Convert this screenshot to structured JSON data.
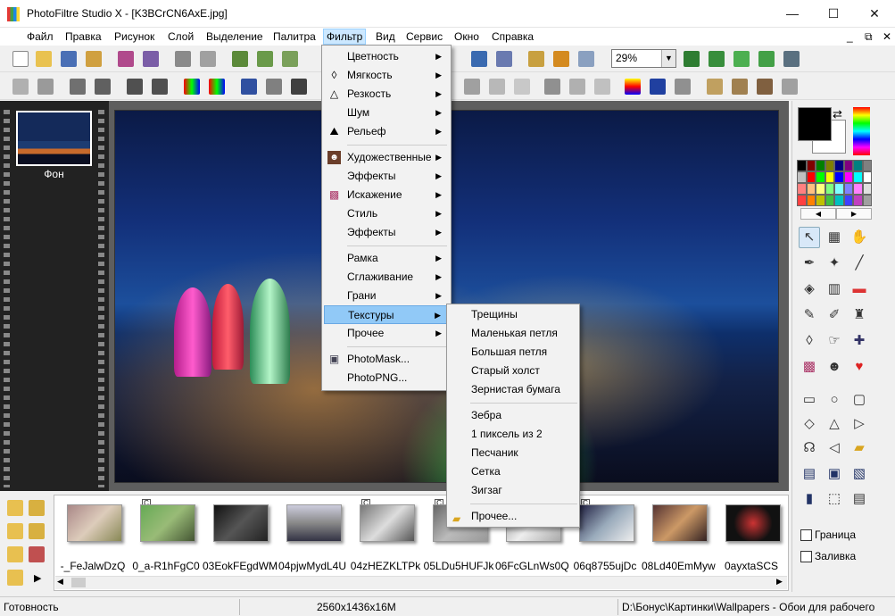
{
  "window": {
    "title": "PhotoFiltre Studio X - [K3BCrCN6AxE.jpg]",
    "minimize": "—",
    "maximize": "☐",
    "close": "✕"
  },
  "menubar": [
    "Файл",
    "Правка",
    "Рисунок",
    "Слой",
    "Выделение",
    "Палитра",
    "Фильтр",
    "Вид",
    "Сервис",
    "Окно",
    "Справка"
  ],
  "mdi": {
    "minimize": "_",
    "restore": "⧉",
    "close": "✕"
  },
  "toolbar": {
    "zoom": "29%"
  },
  "layers": {
    "background_label": "Фон"
  },
  "filter_menu": {
    "items": [
      {
        "label": "Цветность",
        "arrow": "▶"
      },
      {
        "label": "Мягкость",
        "arrow": "▶"
      },
      {
        "label": "Резкость",
        "arrow": "▶"
      },
      {
        "label": "Шум",
        "arrow": "▶"
      },
      {
        "label": "Рельеф",
        "arrow": "▶"
      },
      {
        "label": "Художественные",
        "arrow": "▶"
      },
      {
        "label": "Эффекты",
        "arrow": "▶"
      },
      {
        "label": "Искажение",
        "arrow": "▶"
      },
      {
        "label": "Стиль",
        "arrow": "▶"
      },
      {
        "label": "Эффекты",
        "arrow": "▶"
      },
      {
        "label": "Рамка",
        "arrow": "▶"
      },
      {
        "label": "Сглаживание",
        "arrow": "▶"
      },
      {
        "label": "Грани",
        "arrow": "▶"
      },
      {
        "label": "Текстуры",
        "arrow": "▶"
      },
      {
        "label": "Прочее",
        "arrow": "▶"
      },
      {
        "label": "PhotoMask...",
        "arrow": ""
      },
      {
        "label": "PhotoPNG...",
        "arrow": ""
      }
    ]
  },
  "textures_submenu": [
    "Трещины",
    "Маленькая петля",
    "Большая петля",
    "Старый холст",
    "Зернистая бумага",
    "Зебра",
    "1 пиксель из 2",
    "Песчаник",
    "Сетка",
    "Зигзаг",
    "Прочее..."
  ],
  "browser": {
    "files": [
      "-_FeJalwDzQ",
      "0_a-R1hFgC0",
      "03EokFEgdWM",
      "04pjwMydL4U",
      "04zHEZKLTPk",
      "05LDu5HUFJk",
      "06FcGLnWs0Q",
      "06q8755ujDc",
      "08Ld40EmMyw",
      "0ayxtaSCS"
    ],
    "badge": "C"
  },
  "right_panel": {
    "border_label": "Граница",
    "fill_label": "Заливка",
    "prev": "◀",
    "next": "▶"
  },
  "statusbar": {
    "state": "Готовность",
    "dimensions": "2560x1436x16M",
    "path": "D:\\Бонус\\Картинки\\Wallpapers - Обои для рабочего"
  },
  "palette_colors": [
    "#000000",
    "#800000",
    "#008000",
    "#808000",
    "#000080",
    "#800080",
    "#008080",
    "#808080",
    "#c0c0c0",
    "#ff0000",
    "#00ff00",
    "#ffff00",
    "#0000ff",
    "#ff00ff",
    "#00ffff",
    "#ffffff",
    "#ff8080",
    "#ffc080",
    "#ffff80",
    "#80ff80",
    "#80ffff",
    "#8080ff",
    "#ff80ff",
    "#e0e0e0",
    "#ff4040",
    "#ff8000",
    "#c0c000",
    "#40c040",
    "#00c0c0",
    "#4040ff",
    "#c040c0",
    "#a0a0a0"
  ]
}
